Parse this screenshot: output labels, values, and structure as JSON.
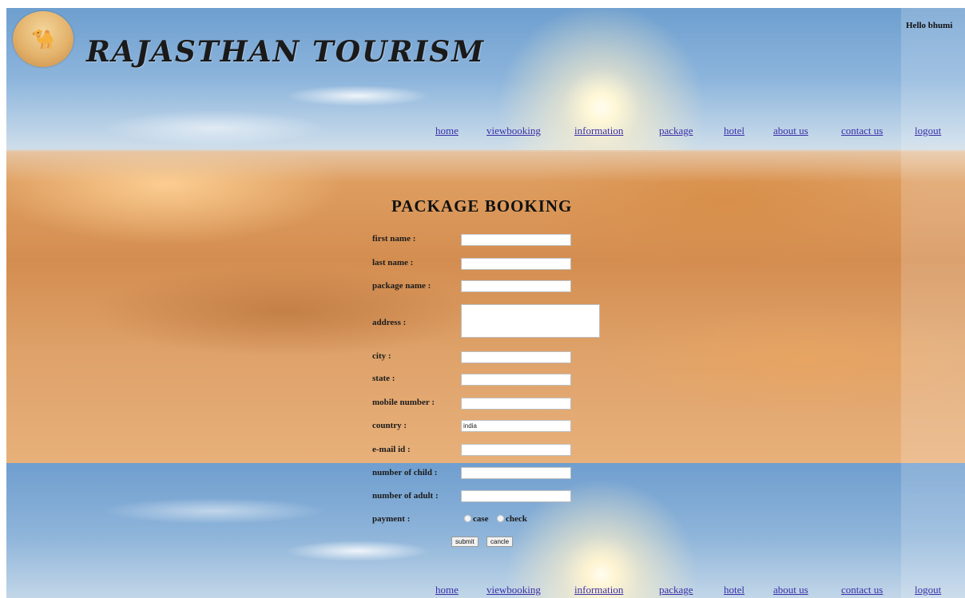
{
  "header": {
    "logo": "camel-rider-logo",
    "title": "RAJASTHAN TOURISM",
    "greeting": "Hello bhumi"
  },
  "nav": {
    "items": [
      "home",
      "viewbooking",
      "information",
      "package",
      "hotel",
      "about us",
      "contact us",
      "logout"
    ]
  },
  "form": {
    "title": "PACKAGE BOOKING",
    "labels": {
      "first_name": "first name :",
      "last_name": "last name :",
      "package_name": "package name :",
      "address": "address :",
      "city": "city :",
      "state": "state :",
      "mobile": "mobile number :",
      "country": "country :",
      "email": "e-mail id :",
      "children": "number of child :",
      "adults": "number of adult :",
      "payment": "payment :"
    },
    "values": {
      "first_name": "",
      "last_name": "",
      "package_name": "",
      "address": "",
      "city": "",
      "state": "",
      "mobile": "",
      "country": "india",
      "email": "",
      "children": "",
      "adults": ""
    },
    "payment_options": [
      "case",
      "check"
    ],
    "submit_label": "submit",
    "cancel_label": "cancle"
  },
  "colors": {
    "link": "#3a2fa8",
    "text": "#1b1b1b"
  }
}
